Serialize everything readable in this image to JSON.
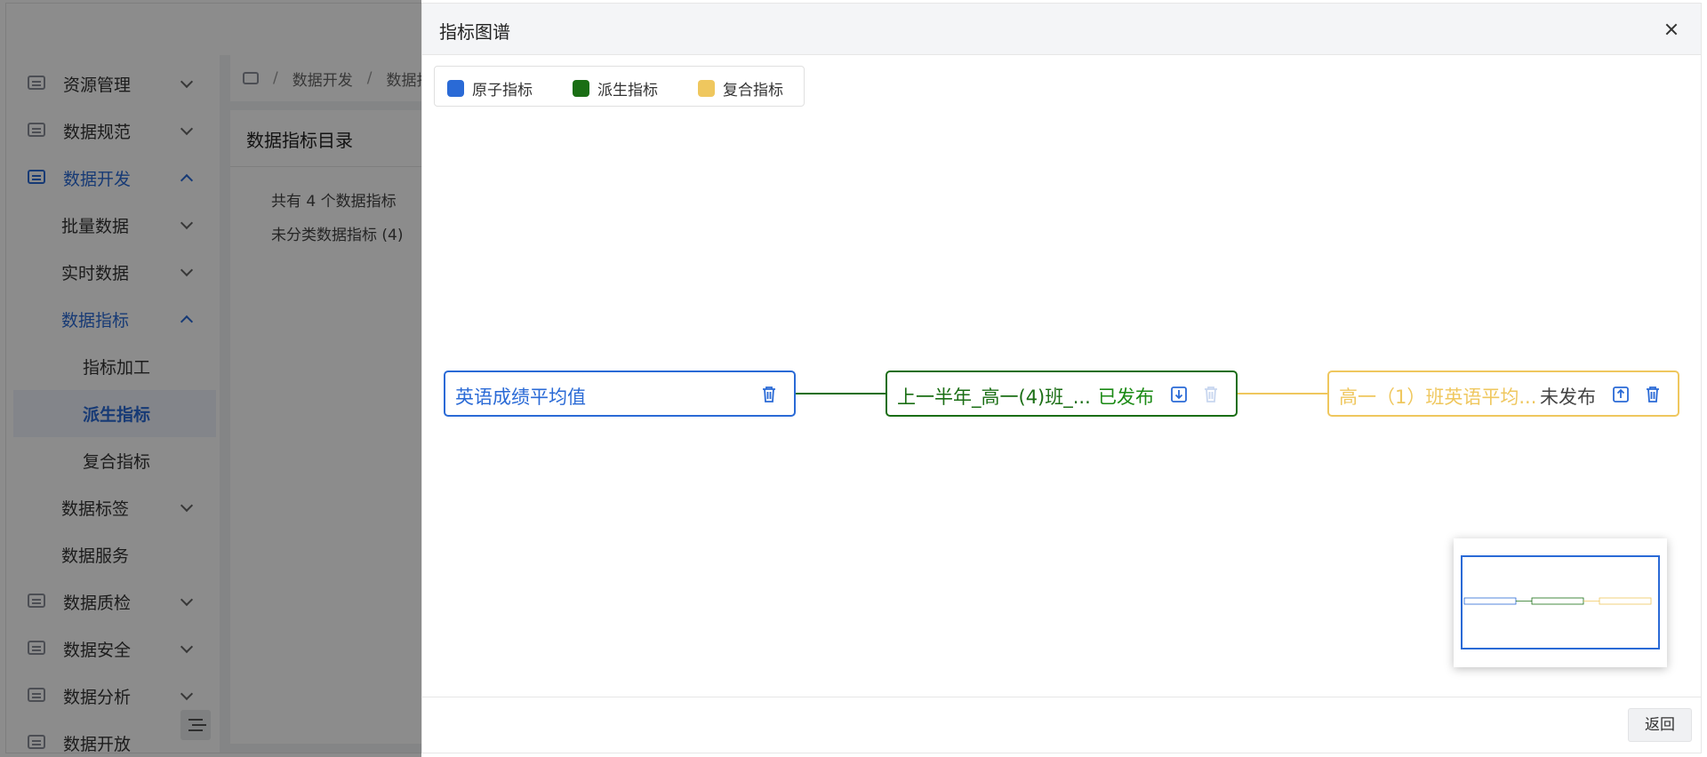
{
  "sidebar": {
    "items": [
      {
        "label": "资源管理",
        "icon": "server-icon"
      },
      {
        "label": "数据规范",
        "icon": "monitor-icon"
      },
      {
        "label": "数据开发",
        "icon": "code-icon"
      },
      {
        "label": "批量数据"
      },
      {
        "label": "实时数据"
      },
      {
        "label": "数据指标"
      },
      {
        "label": "指标加工"
      },
      {
        "label": "派生指标"
      },
      {
        "label": "复合指标"
      },
      {
        "label": "数据标签"
      },
      {
        "label": "数据服务"
      },
      {
        "label": "数据质检",
        "icon": "doc-icon"
      },
      {
        "label": "数据安全",
        "icon": "check-icon"
      },
      {
        "label": "数据分析",
        "icon": "chart-icon"
      },
      {
        "label": "数据开放",
        "icon": "box-icon"
      }
    ]
  },
  "breadcrumb": {
    "sep1": "/",
    "item1": "数据开发",
    "sep2": "/",
    "item2": "数据指"
  },
  "panel": {
    "title": "数据指标目录",
    "count": "共有 4 个数据指标",
    "category": "未分类数据指标 (4)"
  },
  "drawer": {
    "title": "指标图谱",
    "legend": [
      {
        "label": "原子指标",
        "color": "#2a6ad6"
      },
      {
        "label": "派生指标",
        "color": "#1a6e14"
      },
      {
        "label": "复合指标",
        "color": "#efc75e"
      }
    ],
    "nodes": [
      {
        "label": "英语成绩平均值",
        "status": "",
        "color": "#2a6ad6"
      },
      {
        "label": "上一半年_高一(4)班_...",
        "status": "已发布",
        "color": "#1a6e14"
      },
      {
        "label": "高一（1）班英语平均...",
        "status": "未发布",
        "color": "#efc75e"
      }
    ],
    "back_label": "返回"
  }
}
